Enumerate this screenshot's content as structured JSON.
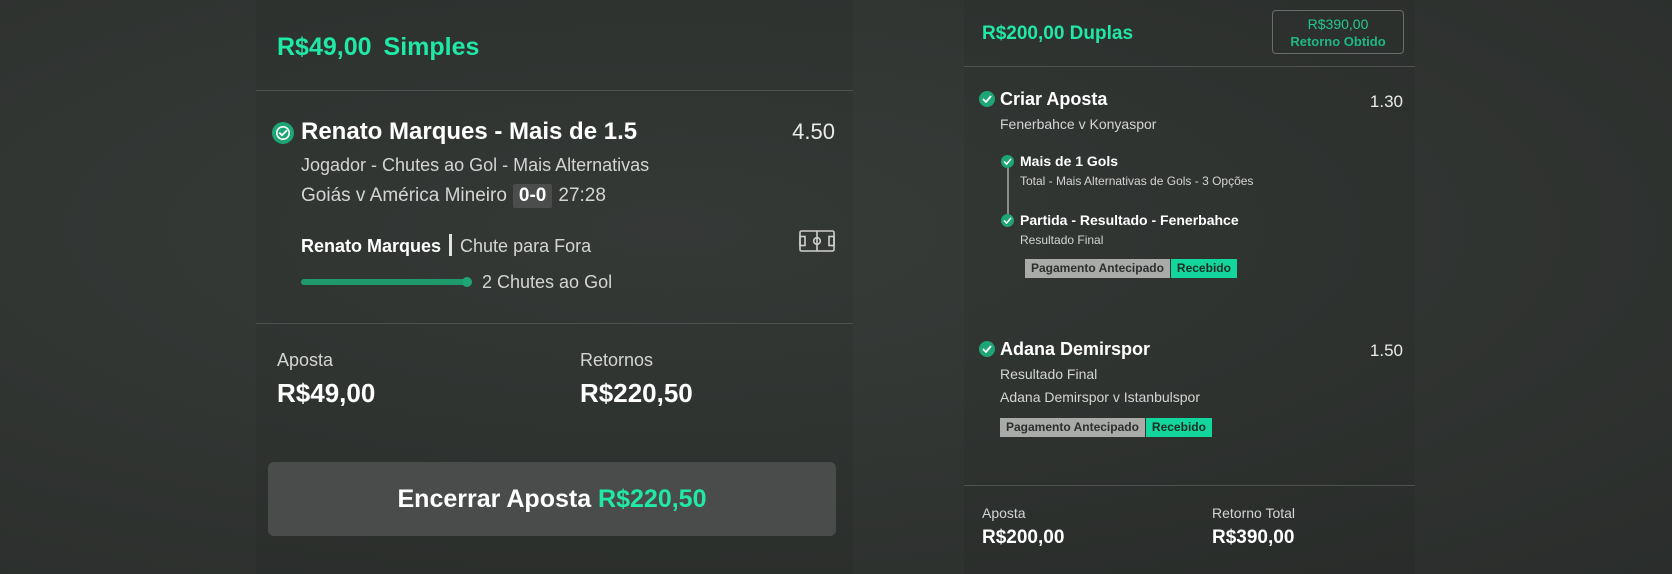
{
  "left": {
    "stake_amount": "R$49,00",
    "bet_type": "Simples",
    "selection": {
      "title": "Renato Marques - Mais de 1.5",
      "odds": "4.50",
      "market": "Jogador - Chutes ao Gol - Mais Alternativas",
      "match": "Goiás v América Mineiro",
      "score": "0-0",
      "time": "27:28",
      "stat_player": "Renato Marques",
      "stat_event": "Chute para Fora",
      "progress_fraction": 1.0,
      "progress_label": "2 Chutes ao Gol"
    },
    "summary": {
      "stake_label": "Aposta",
      "stake_value": "R$49,00",
      "returns_label": "Retornos",
      "returns_value": "R$220,50"
    },
    "cashout": {
      "label": "Encerrar Aposta",
      "amount": "R$220,50"
    }
  },
  "right": {
    "title": "R$200,00 Duplas",
    "return_amount": "R$390,00",
    "return_label": "Retorno Obtido",
    "selections": [
      {
        "title": "Criar Aposta",
        "odds": "1.30",
        "match": "Fenerbahce v Konyaspor",
        "legs": [
          {
            "title": "Mais de 1 Gols",
            "sub": "Total - Mais Alternativas de Gols - 3 Opções"
          },
          {
            "title": "Partida - Resultado - Fenerbahce",
            "sub": "Resultado Final"
          }
        ],
        "badge_grey": "Pagamento Antecipado",
        "badge_green": "Recebido"
      },
      {
        "title": "Adana Demirspor",
        "odds": "1.50",
        "market": "Resultado Final",
        "match": "Adana Demirspor v Istanbulspor",
        "badge_grey": "Pagamento Antecipado",
        "badge_green": "Recebido"
      }
    ],
    "summary": {
      "stake_label": "Aposta",
      "stake_value": "R$200,00",
      "total_label": "Retorno Total",
      "total_value": "R$390,00"
    }
  },
  "colors": {
    "accent": "#20e8a6",
    "check": "#1ea575",
    "badge_grey": "#a9aba9",
    "badge_green": "#13d69c"
  }
}
